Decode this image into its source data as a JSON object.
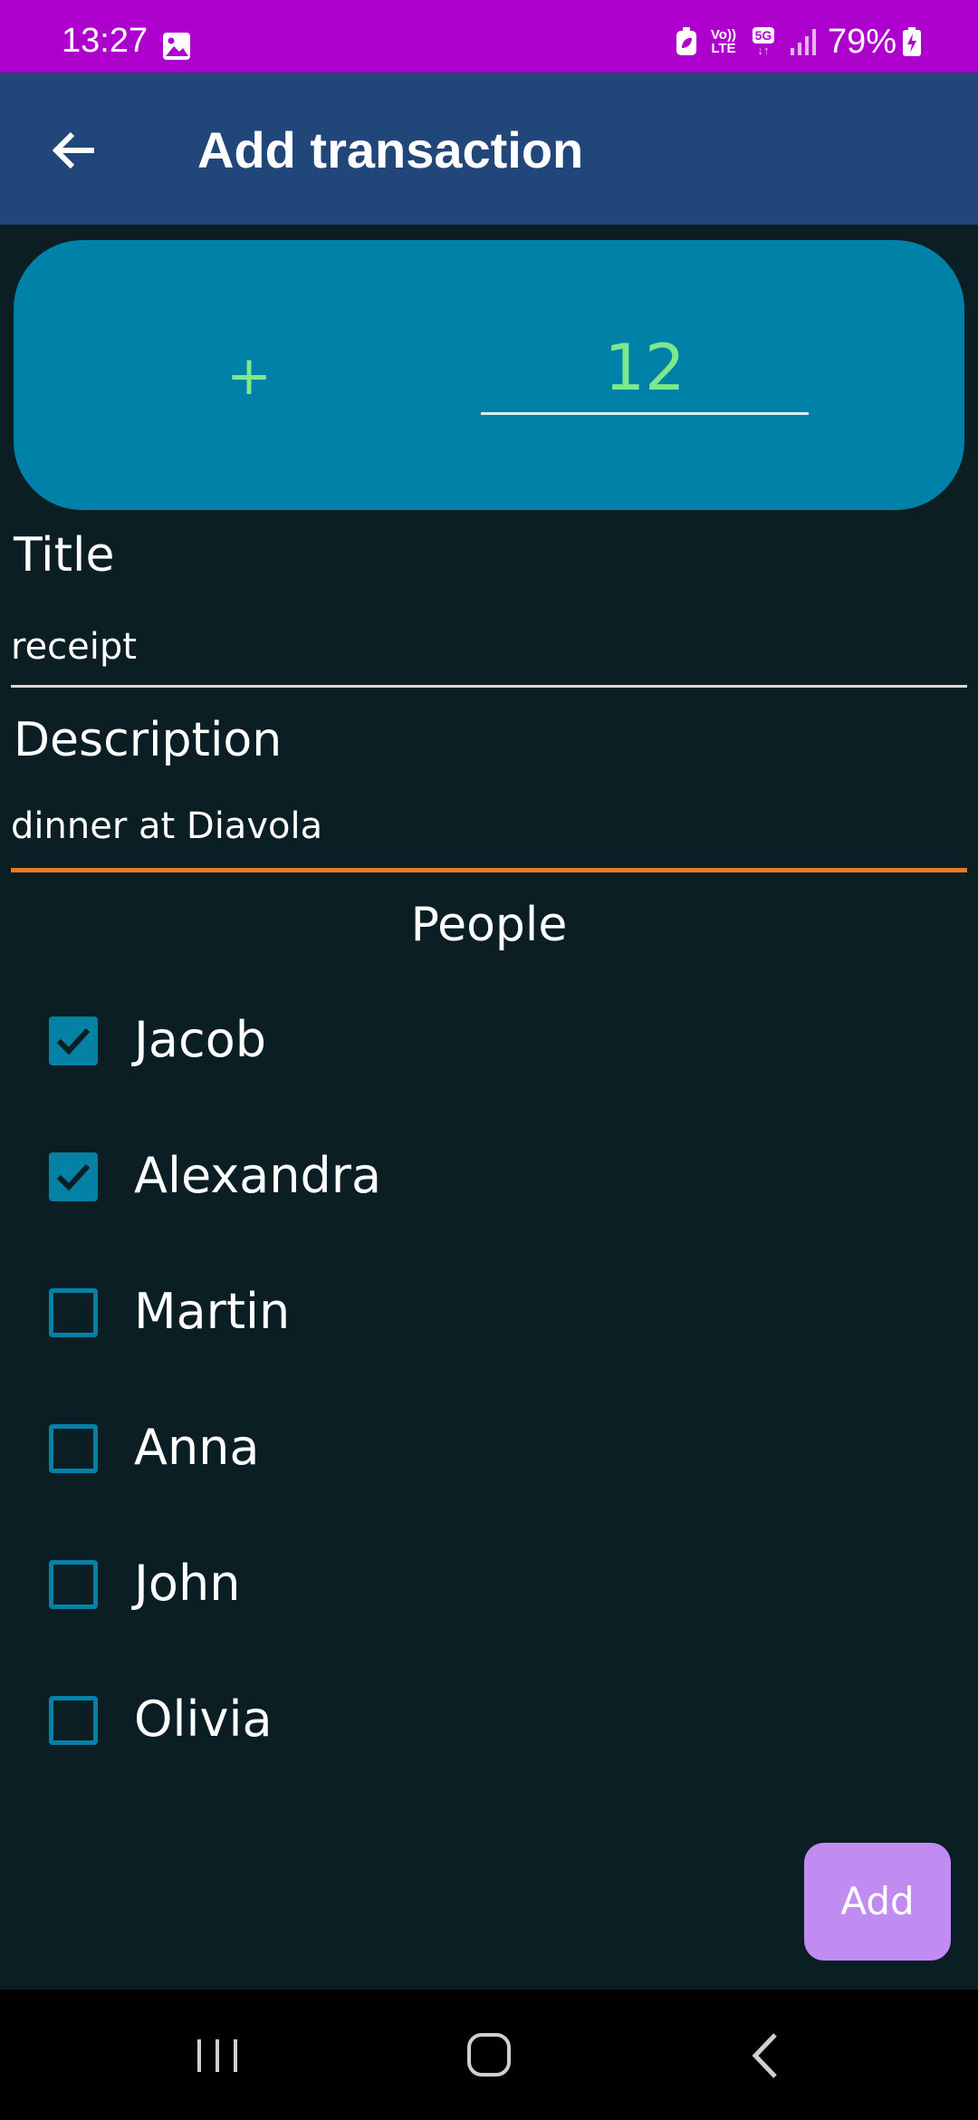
{
  "status_bar": {
    "time": "13:27",
    "battery_percent": "79%",
    "volte_line1": "Vo))",
    "volte_line2": "LTE",
    "network_type": "5G",
    "network_arrows": "↓↑",
    "icons": [
      "gallery-icon",
      "battery-saver-icon",
      "volte-icon",
      "5g-icon",
      "signal-icon",
      "battery-charging-icon"
    ]
  },
  "app_bar": {
    "title": "Add transaction",
    "back_icon": "arrow-left-icon"
  },
  "amount": {
    "sign": "+",
    "value": "12",
    "sign_color": "#7ee88d"
  },
  "form": {
    "title_label": "Title",
    "title_value": "receipt",
    "description_label": "Description",
    "description_value": "dinner at Diavola"
  },
  "people": {
    "heading": "People",
    "list": [
      {
        "name": "Jacob",
        "checked": true
      },
      {
        "name": "Alexandra",
        "checked": true
      },
      {
        "name": "Martin",
        "checked": false
      },
      {
        "name": "Anna",
        "checked": false
      },
      {
        "name": "John",
        "checked": false
      },
      {
        "name": "Olivia",
        "checked": false
      }
    ]
  },
  "actions": {
    "add_label": "Add"
  },
  "colors": {
    "status_bar": "#ad00cc",
    "app_bar": "#21467a",
    "background": "#0a1e24",
    "amount_card": "#0081a7",
    "checkbox": "#0581a6",
    "focused_underline": "#e07c28",
    "add_button": "#c08cf2"
  },
  "nav_bar": {
    "buttons": [
      "recents-icon",
      "home-icon",
      "back-icon"
    ]
  }
}
